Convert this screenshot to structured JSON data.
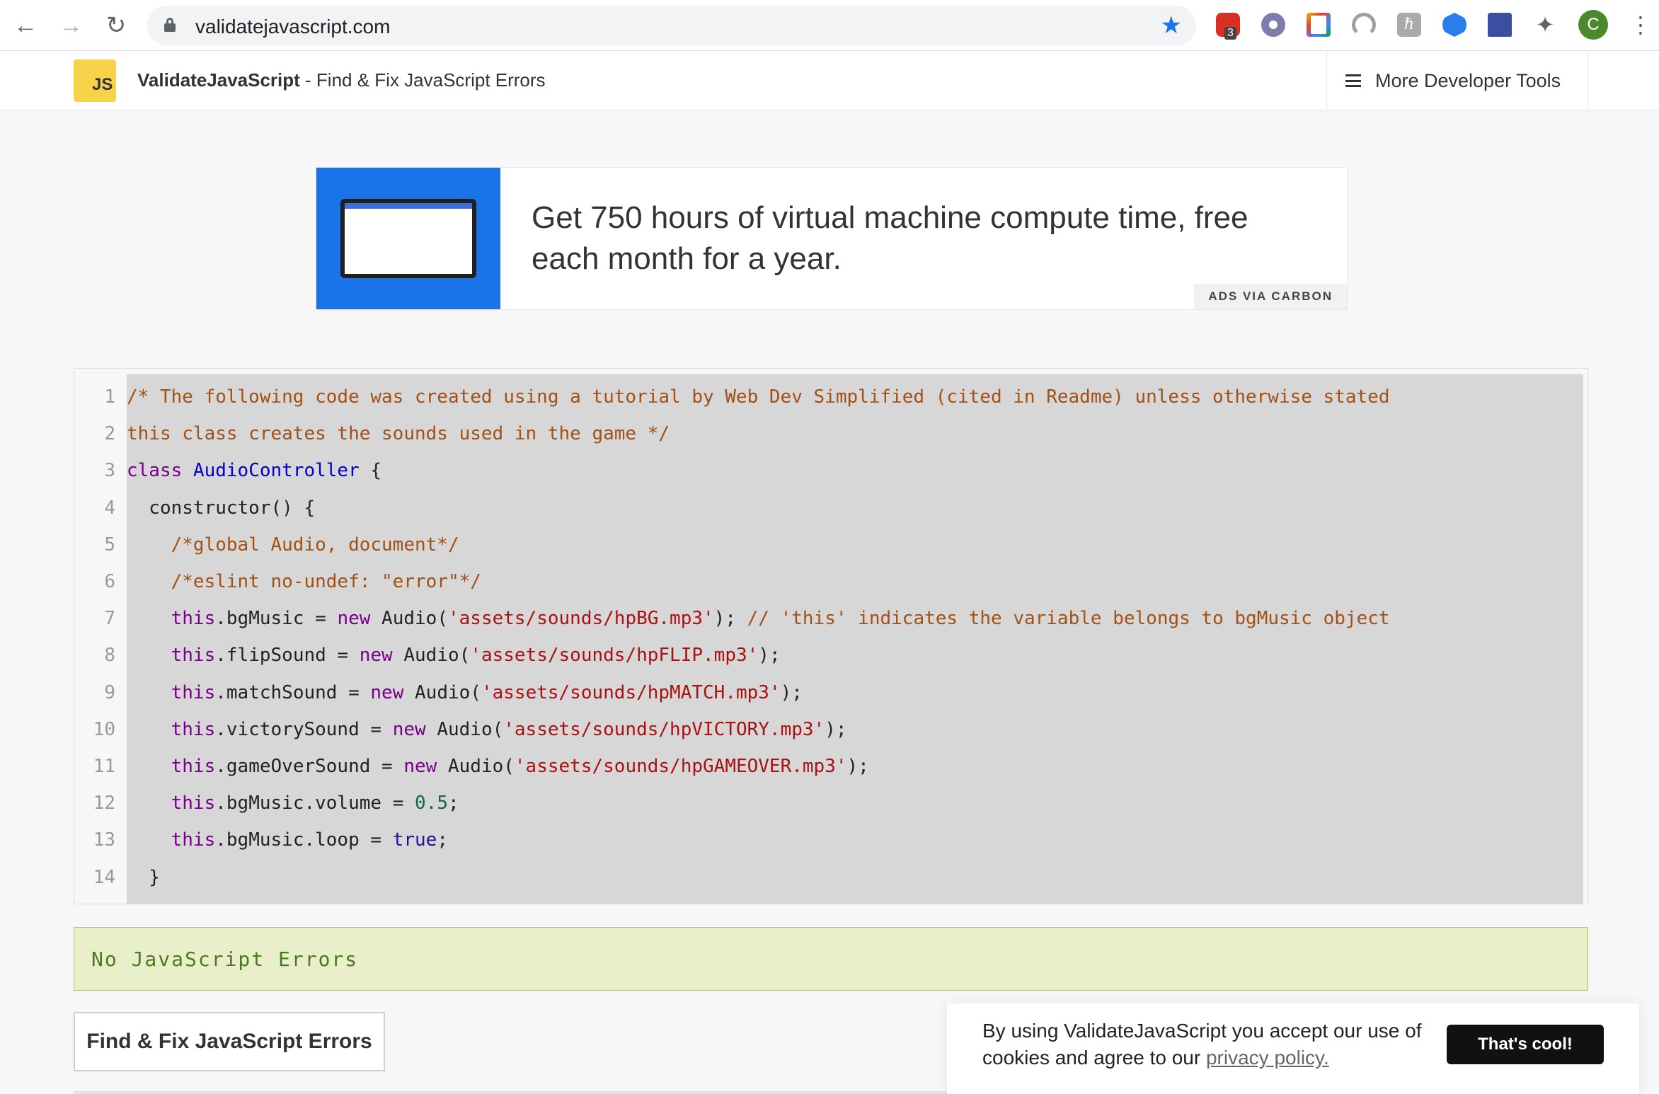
{
  "browser": {
    "url": "validatejavascript.com",
    "extension_badge": "3",
    "profile_initial": "C"
  },
  "header": {
    "logo_text": "JS",
    "brand_name": "ValidateJavaScript",
    "brand_tagline": " - Find & Fix JavaScript Errors",
    "more_tools": "More Developer Tools"
  },
  "ad": {
    "text": "Get 750 hours of virtual machine compute time, free each month for a year.",
    "via": "ADS VIA CARBON"
  },
  "editor": {
    "line_numbers": [
      "1",
      "2",
      "3",
      "4",
      "5",
      "6",
      "7",
      "8",
      "9",
      "10",
      "11",
      "12",
      "13",
      "14"
    ],
    "lines": [
      [
        {
          "t": "/* The following code was created using a tutorial by Web Dev Simplified (cited in Readme) unless otherwise stated",
          "c": "c"
        }
      ],
      [
        {
          "t": "this class creates the sounds used in the game */",
          "c": "c"
        }
      ],
      [
        {
          "t": "class",
          "c": "k"
        },
        {
          "t": " ",
          "c": ""
        },
        {
          "t": "AudioController",
          "c": "d"
        },
        {
          "t": " {",
          "c": ""
        }
      ],
      [
        {
          "t": "  constructor() {",
          "c": ""
        }
      ],
      [
        {
          "t": "    /*global Audio, document*/",
          "c": "c"
        }
      ],
      [
        {
          "t": "    /*eslint no-undef: \"error\"*/",
          "c": "c"
        }
      ],
      [
        {
          "t": "    ",
          "c": ""
        },
        {
          "t": "this",
          "c": "k"
        },
        {
          "t": ".bgMusic = ",
          "c": ""
        },
        {
          "t": "new",
          "c": "k"
        },
        {
          "t": " Audio(",
          "c": ""
        },
        {
          "t": "'assets/sounds/hpBG.mp3'",
          "c": "s"
        },
        {
          "t": "); ",
          "c": ""
        },
        {
          "t": "// 'this' indicates the variable belongs to bgMusic object",
          "c": "c"
        }
      ],
      [
        {
          "t": "    ",
          "c": ""
        },
        {
          "t": "this",
          "c": "k"
        },
        {
          "t": ".flipSound = ",
          "c": ""
        },
        {
          "t": "new",
          "c": "k"
        },
        {
          "t": " Audio(",
          "c": ""
        },
        {
          "t": "'assets/sounds/hpFLIP.mp3'",
          "c": "s"
        },
        {
          "t": ");",
          "c": ""
        }
      ],
      [
        {
          "t": "    ",
          "c": ""
        },
        {
          "t": "this",
          "c": "k"
        },
        {
          "t": ".matchSound = ",
          "c": ""
        },
        {
          "t": "new",
          "c": "k"
        },
        {
          "t": " Audio(",
          "c": ""
        },
        {
          "t": "'assets/sounds/hpMATCH.mp3'",
          "c": "s"
        },
        {
          "t": ");",
          "c": ""
        }
      ],
      [
        {
          "t": "    ",
          "c": ""
        },
        {
          "t": "this",
          "c": "k"
        },
        {
          "t": ".victorySound = ",
          "c": ""
        },
        {
          "t": "new",
          "c": "k"
        },
        {
          "t": " Audio(",
          "c": ""
        },
        {
          "t": "'assets/sounds/hpVICTORY.mp3'",
          "c": "s"
        },
        {
          "t": ");",
          "c": ""
        }
      ],
      [
        {
          "t": "    ",
          "c": ""
        },
        {
          "t": "this",
          "c": "k"
        },
        {
          "t": ".gameOverSound = ",
          "c": ""
        },
        {
          "t": "new",
          "c": "k"
        },
        {
          "t": " Audio(",
          "c": ""
        },
        {
          "t": "'assets/sounds/hpGAMEOVER.mp3'",
          "c": "s"
        },
        {
          "t": ");",
          "c": ""
        }
      ],
      [
        {
          "t": "    ",
          "c": ""
        },
        {
          "t": "this",
          "c": "k"
        },
        {
          "t": ".bgMusic.volume = ",
          "c": ""
        },
        {
          "t": "0.5",
          "c": "n"
        },
        {
          "t": ";",
          "c": ""
        }
      ],
      [
        {
          "t": "    ",
          "c": ""
        },
        {
          "t": "this",
          "c": "k"
        },
        {
          "t": ".bgMusic.loop = ",
          "c": ""
        },
        {
          "t": "true",
          "c": "a"
        },
        {
          "t": ";",
          "c": ""
        }
      ],
      [
        {
          "t": "  }",
          "c": ""
        }
      ]
    ]
  },
  "status": {
    "message": "No JavaScript Errors"
  },
  "actions": {
    "fix_button": "Find & Fix JavaScript Errors"
  },
  "cookie": {
    "text": "By using ValidateJavaScript you accept our use of cookies and agree to our ",
    "link": "privacy policy.",
    "button": "That's cool!"
  }
}
